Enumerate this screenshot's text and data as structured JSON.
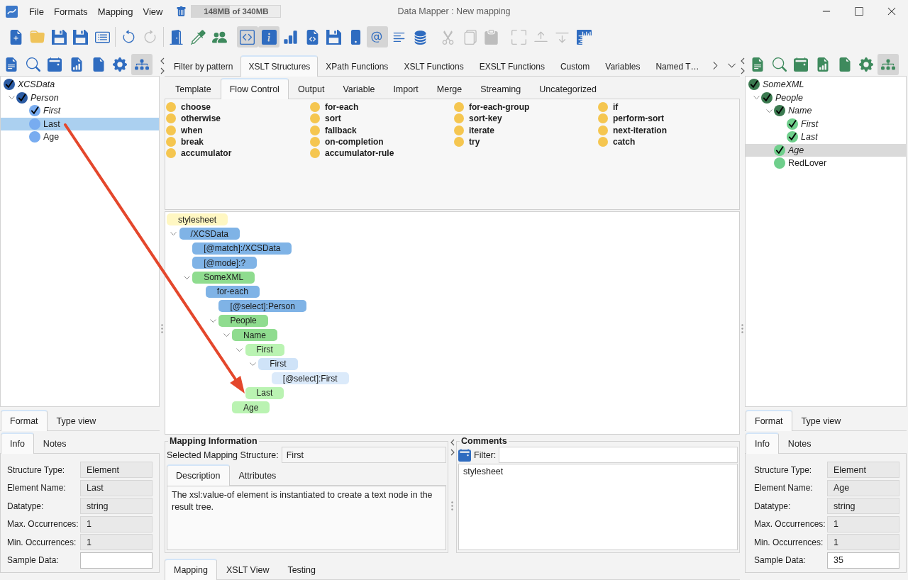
{
  "title_bar": {
    "menu": [
      "File",
      "Formats",
      "Mapping",
      "View"
    ],
    "memory": {
      "text": "148MB of 340MB",
      "level": 0.43
    },
    "title": "Data Mapper : New mapping"
  },
  "toolbar": [
    {
      "kind": "group",
      "buttons": [
        {
          "kind": "new",
          "pressed": false,
          "disabled": false
        },
        {
          "kind": "open",
          "pressed": false,
          "disabled": false
        },
        {
          "kind": "save",
          "pressed": false,
          "disabled": false
        },
        {
          "kind": "save-as",
          "pressed": false,
          "disabled": false
        },
        {
          "kind": "list",
          "pressed": false,
          "disabled": false
        }
      ]
    },
    {
      "kind": "separator"
    },
    {
      "kind": "group",
      "buttons": [
        {
          "kind": "undo",
          "pressed": false,
          "disabled": false
        },
        {
          "kind": "redo",
          "pressed": false,
          "disabled": true
        }
      ]
    },
    {
      "kind": "separator"
    },
    {
      "kind": "group",
      "buttons": [
        {
          "kind": "door",
          "pressed": false,
          "disabled": false
        },
        {
          "kind": "pipette",
          "pressed": false,
          "disabled": false
        },
        {
          "kind": "people",
          "pressed": false,
          "disabled": false
        }
      ]
    },
    {
      "kind": "group",
      "buttons": [
        {
          "kind": "code",
          "pressed": true,
          "disabled": false
        },
        {
          "kind": "info",
          "pressed": true,
          "disabled": false
        },
        {
          "kind": "chart",
          "pressed": false,
          "disabled": false
        },
        {
          "kind": "code-file",
          "pressed": false,
          "disabled": false
        },
        {
          "kind": "save-sync",
          "pressed": false,
          "disabled": false
        },
        {
          "kind": "devices",
          "pressed": false,
          "disabled": false
        },
        {
          "kind": "at",
          "pressed": true,
          "disabled": false
        },
        {
          "kind": "lines",
          "pressed": false,
          "disabled": false
        },
        {
          "kind": "database",
          "pressed": false,
          "disabled": false
        }
      ]
    },
    {
      "kind": "group",
      "buttons": [
        {
          "kind": "cut",
          "pressed": false,
          "disabled": true
        },
        {
          "kind": "copy",
          "pressed": false,
          "disabled": true
        },
        {
          "kind": "paste",
          "pressed": false,
          "disabled": true
        }
      ]
    },
    {
      "kind": "group",
      "buttons": [
        {
          "kind": "expand",
          "pressed": false,
          "disabled": true
        },
        {
          "kind": "move-up",
          "pressed": false,
          "disabled": true
        },
        {
          "kind": "move-down",
          "pressed": false,
          "disabled": true
        },
        {
          "kind": "ruler",
          "pressed": false,
          "disabled": false
        }
      ]
    }
  ],
  "source_panel": {
    "toolbar": [
      {
        "kind": "text-file",
        "pressed": false
      },
      {
        "kind": "search",
        "pressed": false
      },
      {
        "kind": "calendar",
        "pressed": false
      },
      {
        "kind": "chart-file",
        "pressed": false
      },
      {
        "kind": "file",
        "pressed": false
      },
      {
        "kind": "gear",
        "pressed": false
      },
      {
        "kind": "diagram",
        "pressed": true
      }
    ],
    "tree": {
      "focused": true,
      "items": [
        {
          "label": "XCSData",
          "color": "#2b5ba3",
          "mapped": true,
          "selected": false,
          "children": [
            {
              "label": "Person",
              "color": "#2b5ba3",
              "mapped": true,
              "selected": false,
              "expanded": true,
              "children": [
                {
                  "label": "First",
                  "color": "#78acf0",
                  "mapped": true,
                  "selected": false
                },
                {
                  "label": "Last",
                  "color": "#78acf0",
                  "mapped": false,
                  "selected": true
                },
                {
                  "label": "Age",
                  "color": "#78acf0",
                  "mapped": false,
                  "selected": false
                }
              ]
            }
          ]
        }
      ]
    },
    "view_tabs": [
      {
        "label": "Format",
        "selected": true
      },
      {
        "label": "Type view",
        "selected": false
      }
    ],
    "info_tabs": [
      {
        "label": "Info",
        "selected": true
      },
      {
        "label": "Notes",
        "selected": false
      }
    ],
    "fields": [
      {
        "label": "Structure Type:",
        "value": "Element",
        "editable": false
      },
      {
        "label": "Element Name:",
        "value": "Last",
        "editable": false
      },
      {
        "label": "Datatype:",
        "value": "string",
        "editable": false
      },
      {
        "label": "Max. Occurrences:",
        "value": "1",
        "editable": false
      },
      {
        "label": "Min. Occurrences:",
        "value": "1",
        "editable": false
      },
      {
        "label": "Sample Data:",
        "editable": true
      }
    ]
  },
  "center": {
    "category_tabs": [
      {
        "label": "Filter by pattern",
        "selected": false
      },
      {
        "label": "XSLT Structures",
        "selected": true
      },
      {
        "label": "XPath Functions",
        "selected": false
      },
      {
        "label": "XSLT Functions",
        "selected": false
      },
      {
        "label": "EXSLT Functions",
        "selected": false
      },
      {
        "label": "Custom",
        "selected": false
      },
      {
        "label": "Variables",
        "selected": false
      },
      {
        "label": "Named T…",
        "selected": false
      }
    ],
    "subtabs": [
      {
        "label": "Template",
        "selected": false
      },
      {
        "label": "Flow Control",
        "selected": true
      },
      {
        "label": "Output",
        "selected": false
      },
      {
        "label": "Variable",
        "selected": false
      },
      {
        "label": "Import",
        "selected": false
      },
      {
        "label": "Merge",
        "selected": false
      },
      {
        "label": "Streaming",
        "selected": false
      },
      {
        "label": "Uncategorized",
        "selected": false
      }
    ],
    "structures": [
      "choose",
      "for-each",
      "for-each-group",
      "if",
      "otherwise",
      "sort",
      "sort-key",
      "perform-sort",
      "when",
      "fallback",
      "iterate",
      "next-iteration",
      "break",
      "on-completion",
      "try",
      "catch",
      "accumulator",
      "accumulator-rule"
    ],
    "diagram": {
      "nodes": [
        {
          "label": "stylesheet",
          "color": "#fff7c2",
          "children": [
            {
              "label": "/XCSData",
              "color": "#7fb3e6",
              "expanded": true,
              "children": [
                {
                  "label": "[@match]:/XCSData",
                  "color": "#7fb3e6"
                },
                {
                  "label": "[@mode]:?",
                  "color": "#7fb3e6"
                },
                {
                  "label": "SomeXML",
                  "color": "#8fdc8f",
                  "expanded": true,
                  "children": [
                    {
                      "label": "for-each",
                      "color": "#7fb3e6",
                      "children": [
                        {
                          "label": "[@select]:Person",
                          "color": "#7fb3e6"
                        },
                        {
                          "label": "People",
                          "color": "#8fdc8f",
                          "expanded": true,
                          "children": [
                            {
                              "label": "Name",
                              "color": "#8fdc8f",
                              "expanded": true,
                              "children": [
                                {
                                  "label": "First",
                                  "color": "#baf3b2",
                                  "expanded": true,
                                  "children": [
                                    {
                                      "label": "First",
                                      "color": "#cfe3f8",
                                      "expanded": true,
                                      "children": [
                                        {
                                          "label": "[@select]:First",
                                          "color": "#dbeafa"
                                        }
                                      ]
                                    }
                                  ]
                                },
                                {
                                  "label": "Last",
                                  "color": "#baf3b2"
                                }
                              ]
                            },
                            {
                              "label": "Age",
                              "color": "#baf3b2"
                            }
                          ]
                        }
                      ]
                    }
                  ]
                }
              ]
            }
          ]
        }
      ]
    },
    "mapping_information": {
      "title": "Mapping Information",
      "selected_structure": {
        "label": "Selected Mapping Structure:",
        "value": "First"
      },
      "tabs": [
        {
          "label": "Description",
          "selected": true
        },
        {
          "label": "Attributes",
          "selected": false
        }
      ],
      "description": "The xsl:value-of element is instantiated to create a text node in the result tree."
    },
    "comments": {
      "title": "Comments",
      "filter": {
        "label": "Filter:"
      },
      "entries": [
        "stylesheet"
      ]
    },
    "bottom_tabs": [
      {
        "label": "Mapping",
        "selected": true
      },
      {
        "label": "XSLT View",
        "selected": false
      },
      {
        "label": "Testing",
        "selected": false
      }
    ]
  },
  "target_panel": {
    "toolbar": [
      {
        "kind": "text-file",
        "pressed": false
      },
      {
        "kind": "search",
        "pressed": false
      },
      {
        "kind": "calendar",
        "pressed": false
      },
      {
        "kind": "chart-file",
        "pressed": false
      },
      {
        "kind": "file",
        "pressed": false
      },
      {
        "kind": "gear",
        "pressed": false
      },
      {
        "kind": "diagram",
        "pressed": true
      }
    ],
    "tree": {
      "focused": false,
      "items": [
        {
          "label": "SomeXML",
          "color": "#3b7a50",
          "mapped": true,
          "selected": false,
          "children": [
            {
              "label": "People",
              "color": "#3b7a50",
              "mapped": true,
              "selected": false,
              "expanded": true,
              "children": [
                {
                  "label": "Name",
                  "color": "#3b7a50",
                  "mapped": true,
                  "selected": false,
                  "expanded": true,
                  "children": [
                    {
                      "label": "First",
                      "color": "#6fcf8c",
                      "mapped": true,
                      "selected": false
                    },
                    {
                      "label": "Last",
                      "color": "#6fcf8c",
                      "mapped": true,
                      "selected": false
                    }
                  ]
                },
                {
                  "label": "Age",
                  "color": "#6fcf8c",
                  "mapped": true,
                  "selected": true
                },
                {
                  "label": "RedLover",
                  "color": "#6fcf8c",
                  "mapped": false,
                  "selected": false
                }
              ]
            }
          ]
        }
      ]
    },
    "view_tabs": [
      {
        "label": "Format",
        "selected": true
      },
      {
        "label": "Type view",
        "selected": false
      }
    ],
    "info_tabs": [
      {
        "label": "Info",
        "selected": true
      },
      {
        "label": "Notes",
        "selected": false
      }
    ],
    "fields": [
      {
        "label": "Structure Type:",
        "value": "Element",
        "editable": false
      },
      {
        "label": "Element Name:",
        "value": "Age",
        "editable": false
      },
      {
        "label": "Datatype:",
        "value": "string",
        "editable": false
      },
      {
        "label": "Max. Occurrences:",
        "value": "1",
        "editable": false
      },
      {
        "label": "Min. Occurrences:",
        "value": "1",
        "editable": false
      },
      {
        "label": "Sample Data:",
        "value": "35",
        "editable": true
      }
    ]
  }
}
